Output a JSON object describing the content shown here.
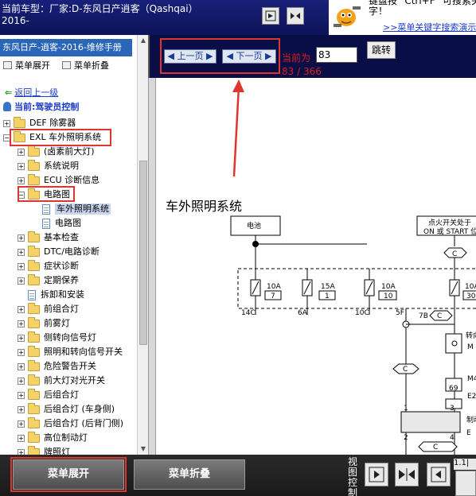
{
  "header": {
    "vehicle_line1": "当前车型：厂家:D-东风日产逍客（Qashqai）",
    "vehicle_line2": "2016-",
    "hint_text_line1": "键盘按 \"Ctrl+F\" 可搜索关键",
    "hint_text_line2": "字！",
    "hint_link": ">>菜单关键字搜索演示"
  },
  "sidebar": {
    "manual_title": "东风日产-逍客-2016-维修手册",
    "expand_label": "菜单展开",
    "collapse_label": "菜单折叠",
    "back_link": "返回上一级",
    "current_node": "当前:驾驶员控制",
    "tree": [
      {
        "label": "DEF 除雾器",
        "type": "folder",
        "expander": "+"
      },
      {
        "label": "EXL 车外照明系统",
        "type": "folder",
        "expander": "−"
      },
      {
        "label": "(卤素前大灯)",
        "type": "folder",
        "expander": "+"
      },
      {
        "label": "系统说明",
        "type": "folder",
        "expander": "+"
      },
      {
        "label": "ECU 诊断信息",
        "type": "folder",
        "expander": "+"
      },
      {
        "label": "电路图",
        "type": "folder",
        "expander": "−"
      },
      {
        "label": "车外照明系统",
        "type": "doc",
        "selected": true
      },
      {
        "label": "电路图",
        "type": "doc"
      },
      {
        "label": "基本检查",
        "type": "folder",
        "expander": "+"
      },
      {
        "label": "DTC/电路诊断",
        "type": "folder",
        "expander": "+"
      },
      {
        "label": "症状诊断",
        "type": "folder",
        "expander": "+"
      },
      {
        "label": "定期保养",
        "type": "folder",
        "expander": "+"
      },
      {
        "label": "拆卸和安装",
        "type": "doc"
      },
      {
        "label": "前组合灯",
        "type": "folder",
        "expander": "+"
      },
      {
        "label": "前雾灯",
        "type": "folder",
        "expander": "+"
      },
      {
        "label": "侧转向信号灯",
        "type": "folder",
        "expander": "+"
      },
      {
        "label": "照明和转向信号开关",
        "type": "folder",
        "expander": "+"
      },
      {
        "label": "危险警告开关",
        "type": "folder",
        "expander": "+"
      },
      {
        "label": "前大灯对光开关",
        "type": "folder",
        "expander": "+"
      },
      {
        "label": "后组合灯",
        "type": "folder",
        "expander": "+"
      },
      {
        "label": "后组合灯 (车身侧)",
        "type": "folder",
        "expander": "+"
      },
      {
        "label": "后组合灯 (后背门侧)",
        "type": "folder",
        "expander": "+"
      },
      {
        "label": "高位制动灯",
        "type": "folder",
        "expander": "+"
      },
      {
        "label": "牌照灯",
        "type": "folder",
        "expander": "+"
      }
    ]
  },
  "viewer": {
    "prev_label": "上一页",
    "next_label": "下一页",
    "current_page_label": "当前为",
    "current_page_value": "83",
    "jump_label": "跳转",
    "page_count": "83 / 366",
    "diagram_title": "车外照明系统",
    "diagram_labels": {
      "battery": "电池",
      "ignition_line1": "点火开关处于",
      "ignition_line2": "ON 或 START 位",
      "c": "C",
      "fuse1_amp": "10A",
      "fuse1_no": "7",
      "fuse1_conn": "14C",
      "fuse2_amp": "15A",
      "fuse2_no": "1",
      "fuse2_conn": "6A",
      "fuse3_amp": "10A",
      "fuse3_no": "10",
      "fuse3_conn": "10C",
      "fuse4_amp": "10A",
      "fuse4_no": "30",
      "fuse4_conn": "5F",
      "conn_7b": "7B",
      "turn": "转向",
      "m": "M",
      "m4": "M4",
      "n69": "69",
      "e2": "E2",
      "pin1": "1",
      "pin3": "3",
      "pin2": "2",
      "pin4": "4",
      "relay": "制动",
      "e": "E"
    }
  },
  "bottom": {
    "expand_label": "菜单展开",
    "collapse_label": "菜单折叠",
    "view_ctrl": "视图控制",
    "zoom": "1.1|"
  }
}
